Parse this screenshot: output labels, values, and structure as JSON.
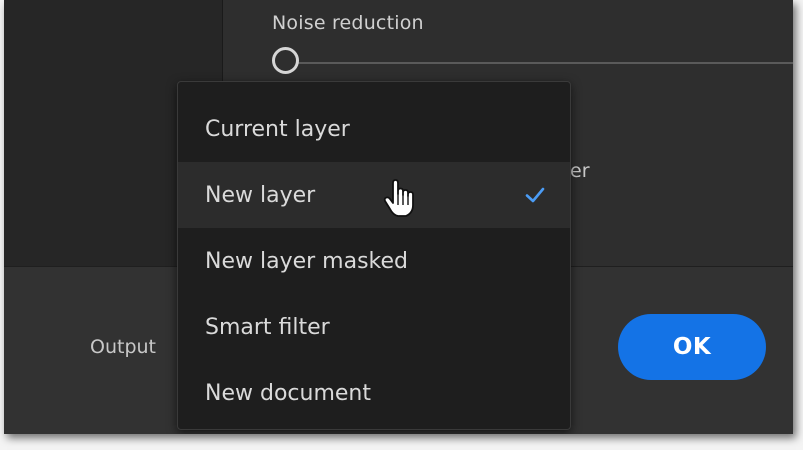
{
  "background_panel": {
    "slider_label": "Noise reduction",
    "slider_value": 0,
    "behind_text": "er"
  },
  "footer": {
    "output_label": "Output",
    "ok_label": "OK"
  },
  "output_menu": {
    "items": [
      {
        "label": "Current layer",
        "selected": false
      },
      {
        "label": "New layer",
        "selected": true
      },
      {
        "label": "New layer masked",
        "selected": false
      },
      {
        "label": "Smart filter",
        "selected": false
      },
      {
        "label": "New document",
        "selected": false
      }
    ],
    "check_icon": "checkmark-icon",
    "cursor_icon": "hand-pointer-icon"
  },
  "colors": {
    "accent": "#1473e6",
    "check": "#4b9cf5",
    "panel": "#2b2b2b",
    "menu": "#1e1e1e"
  }
}
